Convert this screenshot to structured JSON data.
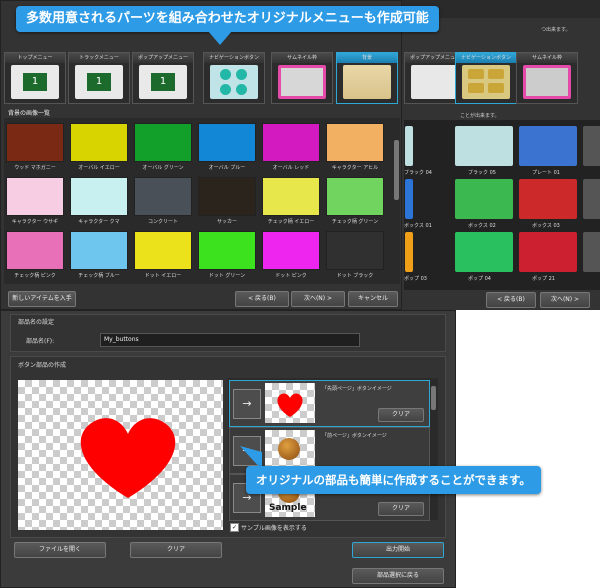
{
  "callout_top": "多数用意されるパーツを組み合わせたオリジナルメニューも作成可能",
  "callout_bottom": "オリジナルの部品も簡単に作成することができます。",
  "back_window": {
    "title_fragment": "つ出来ます。",
    "hint_text": "ことが出来ます。"
  },
  "tabs": [
    {
      "label": "トップメニュー"
    },
    {
      "label": "トラックメニュー"
    },
    {
      "label": "ポップアップメニュー"
    },
    {
      "label": "ナビゲーションボタン"
    },
    {
      "label": "サムネイル枠"
    },
    {
      "label": "背景"
    }
  ],
  "back_tabs": [
    {
      "label": "ポップアップメニュー"
    },
    {
      "label": "ナビゲーションボタン"
    },
    {
      "label": "サムネイル枠"
    }
  ],
  "front_window": {
    "section_title": "背景の画像一覧",
    "items": [
      {
        "label": "ウッド マホガニー",
        "color": "#7a2a14"
      },
      {
        "label": "オーバル イエロー",
        "color": "#d8d400"
      },
      {
        "label": "オーバル グリーン",
        "color": "#12a02a"
      },
      {
        "label": "オーバル ブルー",
        "color": "#1187d6"
      },
      {
        "label": "オーバル レッド",
        "color": "#d21ac0"
      },
      {
        "label": "キャラクター アヒル",
        "color": "#f2b063"
      },
      {
        "label": "キャラクター ウサギ",
        "color": "#f6cde3"
      },
      {
        "label": "キャラクター クマ",
        "color": "#c9f0f0"
      },
      {
        "label": "コンクリート",
        "color": "#4a5058"
      },
      {
        "label": "サッカー",
        "color": "#2a241c"
      },
      {
        "label": "チェック柄 イエロー",
        "color": "#e7e64a"
      },
      {
        "label": "チェック柄 グリーン",
        "color": "#71d45e"
      },
      {
        "label": "チェック柄 ピンク",
        "color": "#e870b8"
      },
      {
        "label": "チェック柄 ブルー",
        "color": "#6ec6ee"
      },
      {
        "label": "ドット イエロー",
        "color": "#ece21c"
      },
      {
        "label": "ドット グリーン",
        "color": "#3de21f"
      },
      {
        "label": "ドット ピンク",
        "color": "#ee25ee"
      },
      {
        "label": "ドット ブラック",
        "color": "#303030"
      }
    ],
    "new_item_button": "新しいアイテムを入手",
    "prev_button": "< 戻る(B)",
    "next_button": "次へ(N) >",
    "cancel_button": "キャンセル"
  },
  "back_grid": {
    "items": [
      {
        "label": "ブラック 04",
        "color": "#bfe0e0"
      },
      {
        "label": "ブラック 05",
        "color": "#3fb04f"
      },
      {
        "label": "プレート 01",
        "color": "#3b74d0"
      },
      {
        "label": "ボックス 01",
        "color": "#2c74d6"
      },
      {
        "label": "ボックス 02",
        "color": "#3cb850"
      },
      {
        "label": "ボックス 03",
        "color": "#cc2a2a"
      },
      {
        "label": "ポップ 03",
        "color": "#f0a018"
      },
      {
        "label": "ポップ 04",
        "color": "#29c060"
      },
      {
        "label": "ポップ 21",
        "color": "#cc2030"
      }
    ],
    "prev_button": "< 戻る(B)",
    "next_button": "次へ(N) >"
  },
  "lower_window": {
    "part_section": "部品名の設定",
    "part_name_label": "部品名(F):",
    "part_name_value": "My_buttons",
    "button_section": "ボタン部品の作成",
    "slots": [
      {
        "title": "「先頭ページ」ボタンイメージ",
        "clear": "クリア"
      },
      {
        "title": "「前ページ」ボタンイメージ",
        "clear": "クリア"
      },
      {
        "title": "",
        "clear": "クリア"
      }
    ],
    "sample_text": "Sample",
    "show_sample_checkbox": "サンプル画像を表示する",
    "open_file_button": "ファイルを開く",
    "clear_button": "クリア",
    "export_button": "出力開始",
    "back_to_parts_button": "部品選択に戻る"
  }
}
